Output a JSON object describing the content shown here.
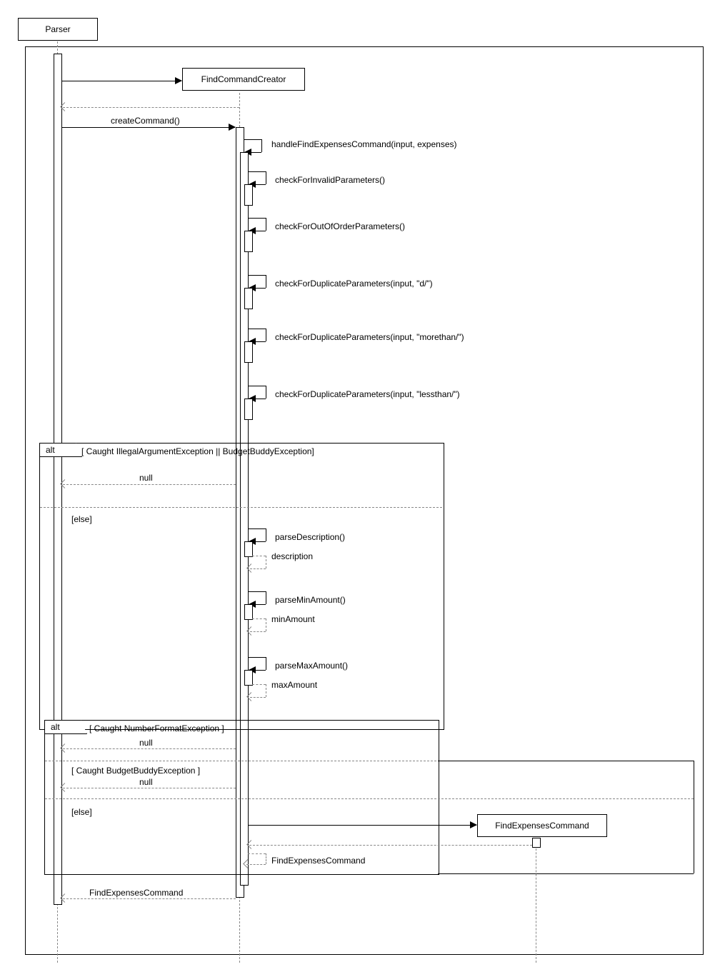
{
  "participants": {
    "parser": "Parser",
    "findCommandCreator": "FindCommandCreator",
    "findExpensesCommand": "FindExpensesCommand"
  },
  "messages": {
    "createCommand": "createCommand()",
    "handleFindExpenses": "handleFindExpensesCommand(input, expenses)",
    "checkInvalid": "checkForInvalidParameters()",
    "checkOutOfOrder": "checkForOutOfOrderParameters()",
    "checkDupD": "checkForDuplicateParameters(input, \"d/\")",
    "checkDupMore": "checkForDuplicateParameters(input, \"morethan/\")",
    "checkDupLess": "checkForDuplicateParameters(input, \"lessthan/\")",
    "parseDesc": "parseDescription()",
    "descReturn": "description",
    "parseMin": "parseMinAmount()",
    "minReturn": "minAmount",
    "parseMax": "parseMaxAmount()",
    "maxReturn": "maxAmount",
    "nullReturn": "null",
    "fecReturn": "FindExpensesCommand"
  },
  "frames": {
    "alt": "alt",
    "guard1": "[ Caught IllegalArgumentException || BudgetBuddyException]",
    "else": "[else]",
    "guard2": "[ Caught NumberFormatException ]",
    "guard3": "[ Caught BudgetBuddyException ]"
  }
}
